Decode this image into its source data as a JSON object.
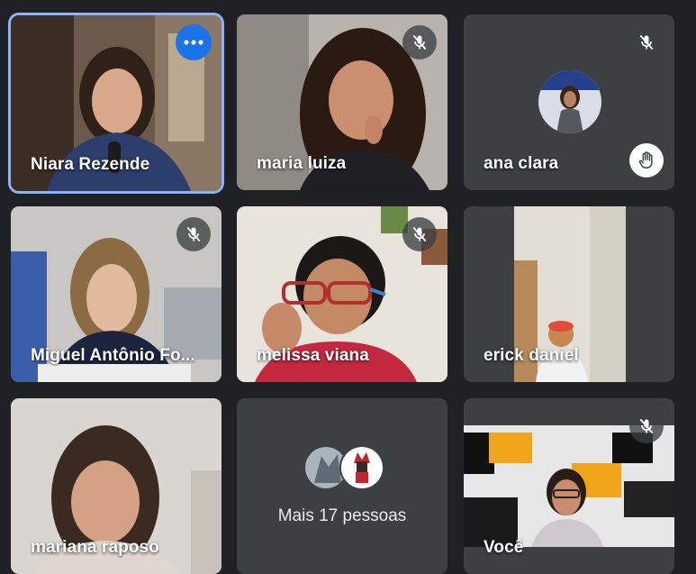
{
  "participants": [
    {
      "name": "Niara Rezende"
    },
    {
      "name": "maria luiza"
    },
    {
      "name": "ana clara"
    },
    {
      "name": "Miguel Antônio Fo..."
    },
    {
      "name": "melissa viana"
    },
    {
      "name": "erick daniel"
    },
    {
      "name": "mariana raposo"
    },
    {
      "more_label": "Mais 17 pessoas"
    },
    {
      "name": "Você"
    }
  ],
  "colors": {
    "background": "#202124",
    "tile": "#3c4043",
    "active_border": "#8ab4f8",
    "more_button": "#1a73e8"
  },
  "icons": {
    "muted": "mic-off-icon",
    "more": "more-options-icon",
    "hand": "raised-hand-icon"
  }
}
